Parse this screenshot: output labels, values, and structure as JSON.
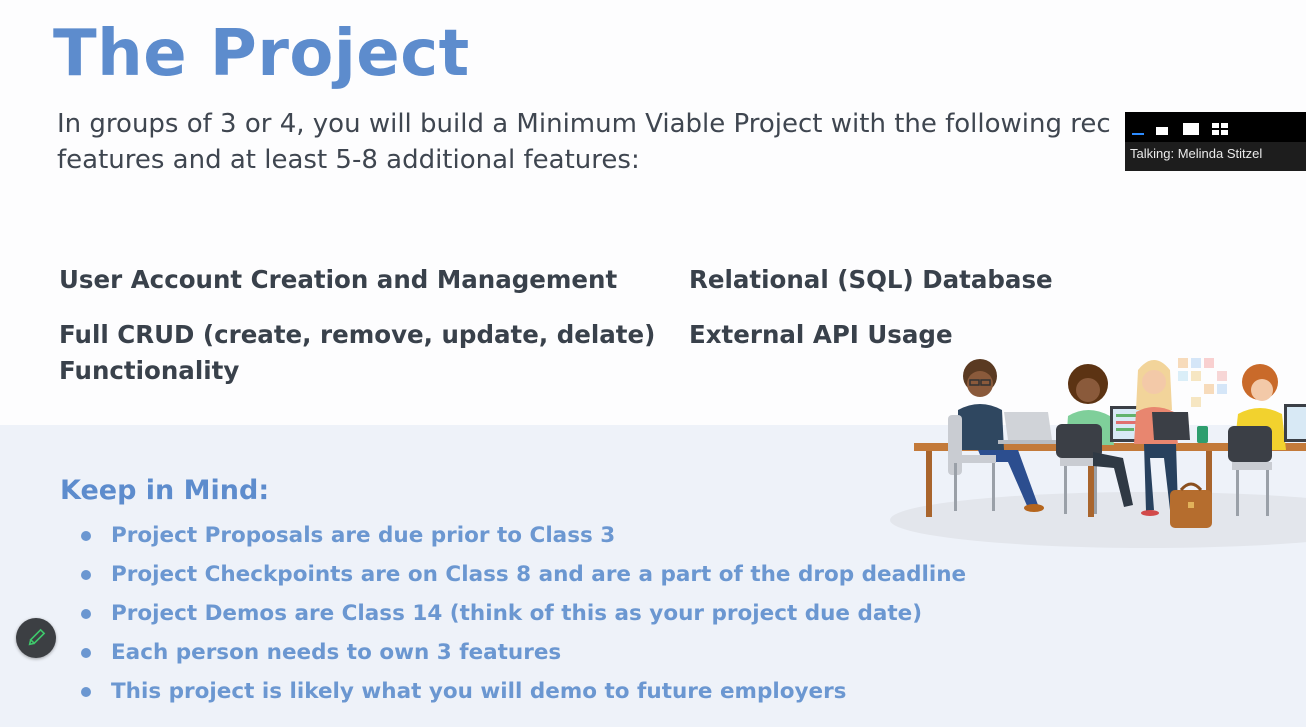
{
  "slide": {
    "title": "The Project",
    "intro_line1": "In groups of 3 or 4, you will build a Minimum Viable Project with the following rec",
    "intro_line2": "features and at least 5-8 additional features:",
    "requirements": {
      "r1": "User Account Creation and Management",
      "r2": "Relational (SQL) Database",
      "r3_line1": "Full CRUD (create, remove, update, delate)",
      "r3_line2": "Functionality",
      "r4": "External API Usage"
    },
    "keep_in_mind": {
      "heading": "Keep in Mind:",
      "items": [
        "Project Proposals are due prior to Class 3",
        "Project Checkpoints are on Class 8 and are a part of the drop deadline",
        "Project Demos are Class 14 (think of this as your project due date)",
        "Each person needs to own 3 features",
        "This project is likely what you will demo to future employers"
      ]
    }
  },
  "overlay": {
    "talking": "Talking: Melinda Stitzel",
    "view_buttons": [
      "minimize-view-icon",
      "small-view-icon",
      "medium-view-icon",
      "gallery-view-icon"
    ],
    "accent": "#2d8cff"
  },
  "tools": {
    "annotate_icon": "pencil-icon",
    "annotate_color": "#3ec86b"
  },
  "colors": {
    "title": "#5d8ccd",
    "body_text": "#39414b",
    "bullet": "#6b97d1",
    "lower_bg": "#eef2f9"
  }
}
